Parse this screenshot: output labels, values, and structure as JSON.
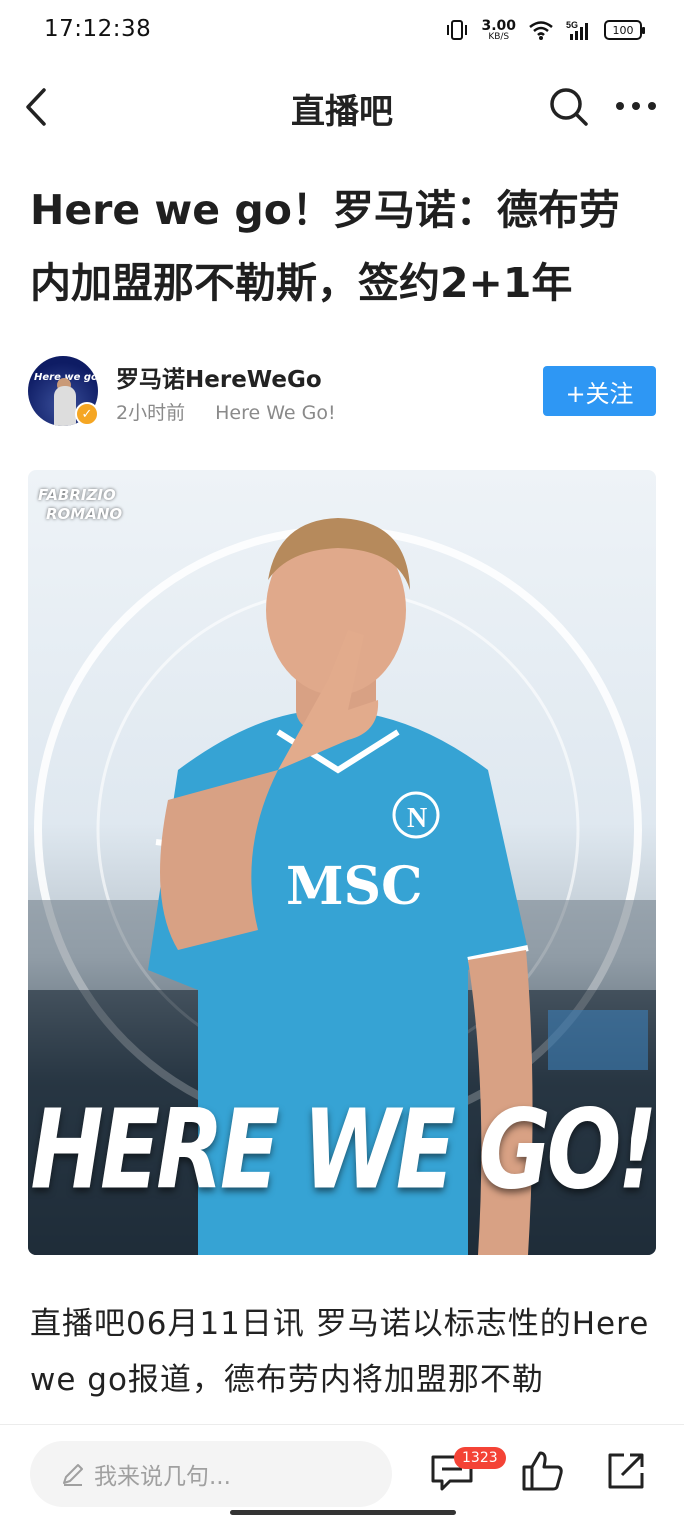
{
  "status_bar": {
    "time": "17:12:38",
    "net_speed_value": "3.00",
    "net_speed_unit": "KB/S",
    "network": "5G",
    "battery": "100"
  },
  "nav": {
    "title": "直播吧",
    "icons": [
      "back-arrow-icon",
      "search-icon",
      "more-icon"
    ]
  },
  "article": {
    "headline": "Here we go！罗马诺：德布劳内加盟那不勒斯，签约2+1年",
    "author": {
      "name": "罗马诺HereWeGo",
      "time": "2小时前",
      "source": "Here We Go!",
      "avatar_text": "Here we go",
      "follow_label": "+关注"
    },
    "hero_image": {
      "watermark_line1": "FABRIZIO",
      "watermark_line2": "ROMANO",
      "jersey_text": "MSC",
      "slogan": "HERE WE GO!"
    },
    "body": "直播吧06月11日讯 罗马诺以标志性的Here we go报道，德布劳内将加盟那不勒"
  },
  "bottom_bar": {
    "comment_placeholder": "我来说几句...",
    "comment_count": "1323",
    "icons": [
      "comment-icon",
      "like-icon",
      "share-icon"
    ]
  },
  "colors": {
    "accent": "#2e97f4",
    "badge": "#f44336",
    "verified": "#f5a623"
  }
}
